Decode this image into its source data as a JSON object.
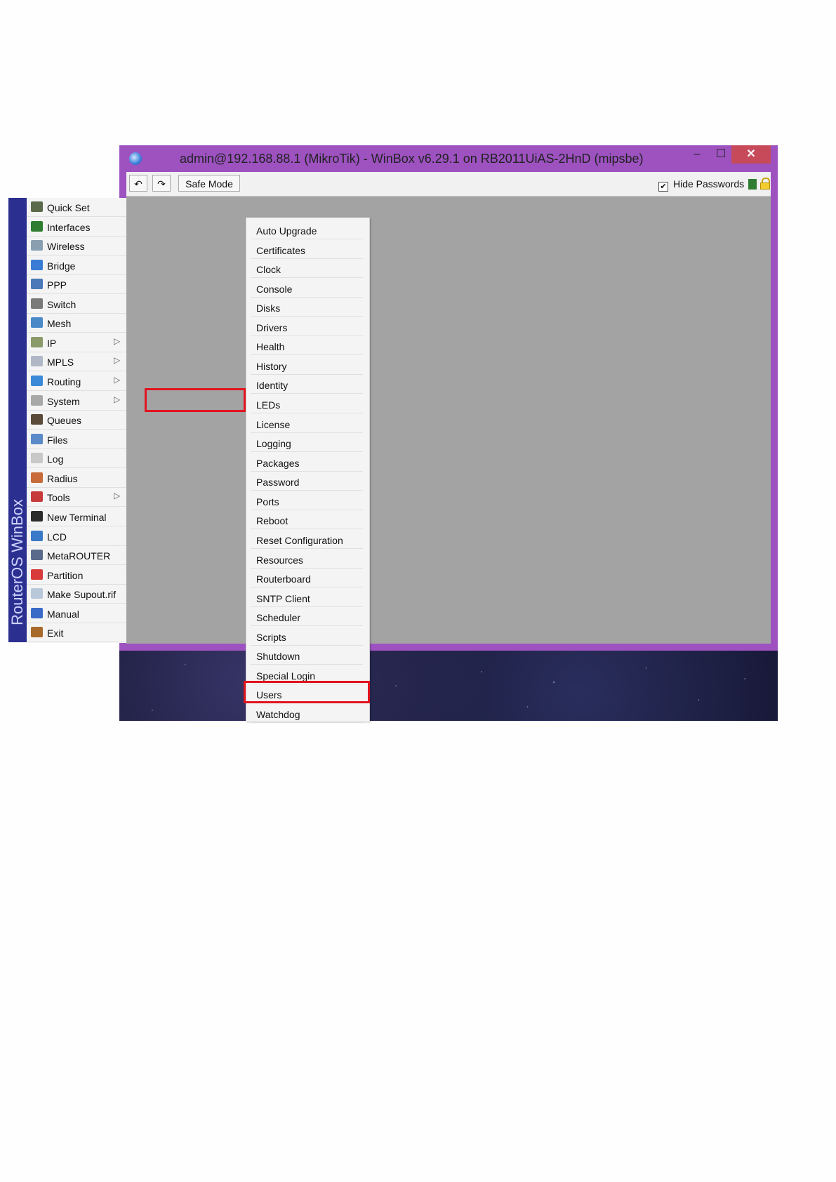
{
  "window": {
    "title": "admin@192.168.88.1 (MikroTik) - WinBox v6.29.1 on RB2011UiAS-2HnD (mipsbe)",
    "minimize": "–",
    "maximize": "☐",
    "close": "✕",
    "accent": "#9d52c0"
  },
  "toolbar": {
    "undo": "↶",
    "redo": "↷",
    "safe_mode": "Safe Mode",
    "hide_passwords": "Hide Passwords",
    "hide_passwords_checked": "✔"
  },
  "sidebar": {
    "brand": "RouterOS WinBox",
    "items": [
      {
        "label": "Quick Set",
        "icon": "quick-set-icon",
        "color": "#5a6a4a"
      },
      {
        "label": "Interfaces",
        "icon": "interfaces-icon",
        "color": "#2f7d32"
      },
      {
        "label": "Wireless",
        "icon": "wireless-icon",
        "color": "#8aa0b0"
      },
      {
        "label": "Bridge",
        "icon": "bridge-icon",
        "color": "#3a7bd5"
      },
      {
        "label": "PPP",
        "icon": "ppp-icon",
        "color": "#4a78b8"
      },
      {
        "label": "Switch",
        "icon": "switch-icon",
        "color": "#7a7a7a"
      },
      {
        "label": "Mesh",
        "icon": "mesh-icon",
        "color": "#4a88c8"
      },
      {
        "label": "IP",
        "icon": "ip-icon",
        "color": "#8a9a6a",
        "submenu": "▷"
      },
      {
        "label": "MPLS",
        "icon": "mpls-icon",
        "color": "#b0b8c8",
        "submenu": "▷"
      },
      {
        "label": "Routing",
        "icon": "routing-icon",
        "color": "#3a88d8",
        "submenu": "▷"
      },
      {
        "label": "System",
        "icon": "system-gear-icon",
        "color": "#a8a8a8",
        "submenu": "▷"
      },
      {
        "label": "Queues",
        "icon": "queues-icon",
        "color": "#5a4a3a"
      },
      {
        "label": "Files",
        "icon": "files-icon",
        "color": "#5a8ac8"
      },
      {
        "label": "Log",
        "icon": "log-icon",
        "color": "#c8c8c8"
      },
      {
        "label": "Radius",
        "icon": "radius-icon",
        "color": "#c86a3a"
      },
      {
        "label": "Tools",
        "icon": "tools-icon",
        "color": "#c83a3a",
        "submenu": "▷"
      },
      {
        "label": "New Terminal",
        "icon": "terminal-icon",
        "color": "#2a2a2a"
      },
      {
        "label": "LCD",
        "icon": "lcd-icon",
        "color": "#3a78c8"
      },
      {
        "label": "MetaROUTER",
        "icon": "metarouter-icon",
        "color": "#5a6a8a"
      },
      {
        "label": "Partition",
        "icon": "partition-icon",
        "color": "#d83a3a"
      },
      {
        "label": "Make Supout.rif",
        "icon": "supout-icon",
        "color": "#b8c8d8"
      },
      {
        "label": "Manual",
        "icon": "manual-icon",
        "color": "#3a6ac8"
      },
      {
        "label": "Exit",
        "icon": "exit-icon",
        "color": "#a86a2a"
      }
    ]
  },
  "submenu": {
    "items": [
      "Auto Upgrade",
      "Certificates",
      "Clock",
      "Console",
      "Disks",
      "Drivers",
      "Health",
      "History",
      "Identity",
      "LEDs",
      "License",
      "Logging",
      "Packages",
      "Password",
      "Ports",
      "Reboot",
      "Reset Configuration",
      "Resources",
      "Routerboard",
      "SNTP Client",
      "Scheduler",
      "Scripts",
      "Shutdown",
      "Special Login",
      "Users",
      "Watchdog"
    ]
  }
}
